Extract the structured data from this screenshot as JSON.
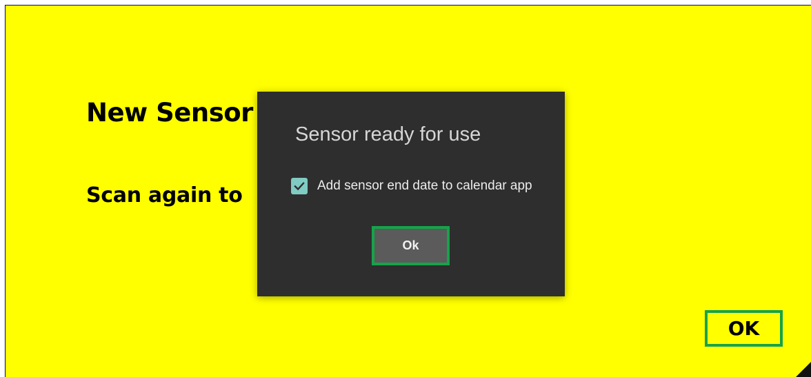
{
  "background": {
    "title": "New Sensor",
    "subtitle": "Scan again to",
    "ok_label": "OK"
  },
  "dialog": {
    "title": "Sensor ready for use",
    "checkbox": {
      "label": "Add sensor end date to calendar app",
      "checked": true
    },
    "ok_label": "Ok"
  },
  "colors": {
    "screen_background": "#ffff00",
    "dialog_background": "#2e2e2e",
    "checkbox_accent": "#80cbc4",
    "highlight_border": "#16a34a"
  },
  "icons": {
    "checkbox": "checkmark-icon"
  }
}
